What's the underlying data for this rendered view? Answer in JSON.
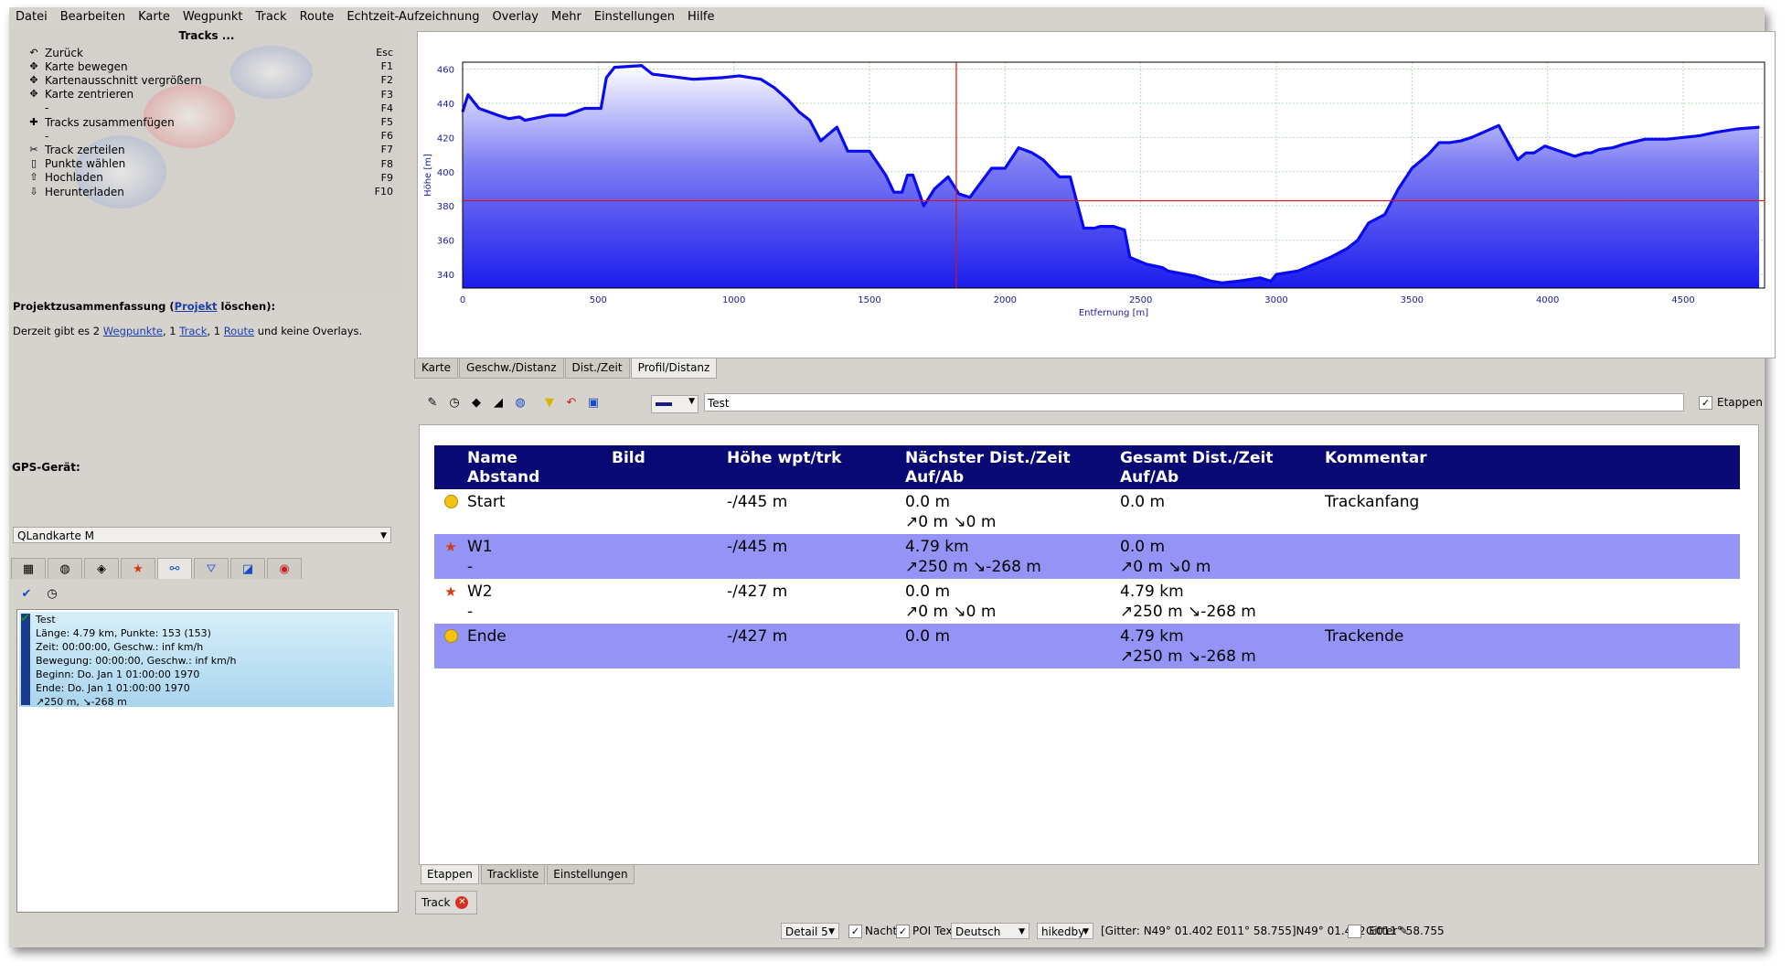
{
  "menu": [
    "Datei",
    "Bearbeiten",
    "Karte",
    "Wegpunkt",
    "Track",
    "Route",
    "Echtzeit-Aufzeichnung",
    "Overlay",
    "Mehr",
    "Einstellungen",
    "Hilfe"
  ],
  "actions": {
    "title": "Tracks ...",
    "items": [
      {
        "icon": "back-arrow-icon",
        "glyph": "↶",
        "label": "Zurück",
        "key": "Esc"
      },
      {
        "icon": "move-icon",
        "glyph": "✥",
        "label": "Karte bewegen",
        "key": "F1"
      },
      {
        "icon": "zoom-icon",
        "glyph": "✥",
        "label": "Kartenausschnitt vergrößern",
        "key": "F2"
      },
      {
        "icon": "center-icon",
        "glyph": "✥",
        "label": "Karte zentrieren",
        "key": "F3"
      },
      {
        "icon": "",
        "glyph": "",
        "label": "-",
        "key": "F4"
      },
      {
        "icon": "join-tracks-icon",
        "glyph": "✚",
        "label": "Tracks zusammenfügen",
        "key": "F5"
      },
      {
        "icon": "",
        "glyph": "",
        "label": "-",
        "key": "F6"
      },
      {
        "icon": "split-track-icon",
        "glyph": "✂",
        "label": "Track zerteilen",
        "key": "F7"
      },
      {
        "icon": "select-points-icon",
        "glyph": "▯",
        "label": "Punkte wählen",
        "key": "F8"
      },
      {
        "icon": "upload-icon",
        "glyph": "⇧",
        "label": "Hochladen",
        "key": "F9"
      },
      {
        "icon": "download-icon",
        "glyph": "⇩",
        "label": "Herunterladen",
        "key": "F10"
      }
    ]
  },
  "summary": {
    "title_pre": "Projektzusammenfassung (",
    "title_link": "Projekt",
    "title_post": " löschen):",
    "text": {
      "p1": "Derzeit gibt es 2 ",
      "wp": "Wegpunkte",
      "p2": ", 1 ",
      "trk": "Track",
      "p3": ", 1 ",
      "rte": "Route",
      "p4": " und keine Overlays."
    }
  },
  "gps": {
    "label": "GPS-Gerät:",
    "selected": "QLandkarte M"
  },
  "track_item": {
    "lines": [
      "Test",
      "Länge: 4.79 km, Punkte: 153 (153)",
      "Zeit:  00:00:00, Geschw.: inf km/h",
      "Bewegung: 00:00:00, Geschw.: inf km/h",
      "Beginn: Do. Jan 1 01:00:00 1970",
      "Ende: Do. Jan 1 01:00:00 1970",
      "↗250 m, ↘-268 m"
    ]
  },
  "chart_data": {
    "type": "area",
    "xlabel": "Entfernung [m]",
    "ylabel": "Höhe [m]",
    "xlim": [
      0,
      4800
    ],
    "ylim": [
      332,
      464
    ],
    "xticks": [
      0,
      500,
      1000,
      1500,
      2000,
      2500,
      3000,
      3500,
      4000,
      4500
    ],
    "yticks": [
      340,
      360,
      380,
      400,
      420,
      440,
      460
    ],
    "grid": true,
    "cursor": {
      "x": 1820,
      "y": 383
    },
    "series": [
      {
        "color": "#0a0af2",
        "x": [
          0,
          20,
          60,
          130,
          170,
          210,
          230,
          320,
          380,
          450,
          510,
          530,
          560,
          660,
          700,
          850,
          960,
          1020,
          1100,
          1150,
          1200,
          1240,
          1280,
          1320,
          1380,
          1420,
          1500,
          1560,
          1590,
          1620,
          1640,
          1660,
          1700,
          1740,
          1790,
          1830,
          1870,
          1950,
          2000,
          2050,
          2100,
          2140,
          2200,
          2240,
          2290,
          2330,
          2350,
          2400,
          2440,
          2460,
          2520,
          2580,
          2600,
          2700,
          2760,
          2800,
          2860,
          2940,
          2980,
          3000,
          3080,
          3200,
          3260,
          3300,
          3340,
          3400,
          3450,
          3500,
          3560,
          3600,
          3640,
          3680,
          3720,
          3820,
          3890,
          3920,
          3950,
          3990,
          4100,
          4140,
          4160,
          4190,
          4240,
          4280,
          4360,
          4440,
          4500,
          4560,
          4620,
          4700,
          4780
        ],
        "values": [
          435,
          445,
          437,
          433,
          431,
          432,
          430,
          433,
          433,
          437,
          437,
          455,
          461,
          462,
          457,
          454,
          455,
          456,
          454,
          449,
          442,
          435,
          430,
          418,
          426,
          412,
          412,
          398,
          388,
          388,
          398,
          398,
          380,
          390,
          397,
          387,
          385,
          402,
          402,
          414,
          411,
          407,
          397,
          397,
          367,
          367,
          368,
          368,
          366,
          350,
          346,
          344,
          342,
          339,
          336,
          335,
          336,
          338,
          336,
          340,
          342,
          350,
          355,
          360,
          370,
          375,
          390,
          402,
          410,
          417,
          417,
          418,
          420,
          427,
          407,
          411,
          411,
          415,
          409,
          411,
          411,
          413,
          414,
          416,
          419,
          419,
          420,
          421,
          423,
          425,
          426
        ]
      }
    ]
  },
  "chart_tabs": [
    "Karte",
    "Geschw./Distanz",
    "Dist./Zeit",
    "Profil/Distanz"
  ],
  "etappen_bar": {
    "name_value": "Test",
    "checkbox_label": "Etappen"
  },
  "stages": {
    "headers": [
      {
        "l1": "Name",
        "l2": "Abstand"
      },
      {
        "l1": "Bild",
        "l2": ""
      },
      {
        "l1": "Höhe wpt/trk",
        "l2": ""
      },
      {
        "l1": "Nächster Dist./Zeit",
        "l2": "Auf/Ab"
      },
      {
        "l1": "Gesamt Dist./Zeit",
        "l2": "Auf/Ab"
      },
      {
        "l1": "Kommentar",
        "l2": ""
      }
    ],
    "rows": [
      {
        "icon": "smiley-icon",
        "name": "Start",
        "abstand": "",
        "bild": "",
        "hoehe": "-/445 m",
        "next1": "0.0 m",
        "next2": "↗0 m ↘0 m",
        "total1": "0.0 m",
        "total2": "",
        "comment": "Trackanfang"
      },
      {
        "icon": "star-icon",
        "name": "W1",
        "abstand": "-",
        "bild": "",
        "hoehe": "-/445 m",
        "next1": "4.79 km",
        "next2": "↗250 m ↘-268 m",
        "total1": "0.0 m",
        "total2": "↗0 m ↘0 m",
        "comment": ""
      },
      {
        "icon": "star-icon",
        "name": "W2",
        "abstand": "-",
        "bild": "",
        "hoehe": "-/427 m",
        "next1": "0.0 m",
        "next2": "↗0 m ↘0 m",
        "total1": "4.79 km",
        "total2": "↗250 m ↘-268 m",
        "comment": ""
      },
      {
        "icon": "smiley-icon",
        "name": "Ende",
        "abstand": "",
        "bild": "",
        "hoehe": "-/427 m",
        "next1": "0.0 m",
        "next2": "",
        "total1": "4.79 km",
        "total2": "↗250 m ↘-268 m",
        "comment": "Trackende"
      }
    ]
  },
  "bottom_tabs": [
    "Etappen",
    "Trackliste",
    "Einstellungen"
  ],
  "track_tab": {
    "label": "Track"
  },
  "status": {
    "detail": "Detail 5",
    "nacht": "Nacht",
    "poi": "POI Text",
    "language": "Deutsch",
    "map_style": "hikedby",
    "coords": "[Gitter: N49° 01.402 E011° 58.755]N49° 01.402 E011° 58.755",
    "gitter": "Gitter"
  }
}
